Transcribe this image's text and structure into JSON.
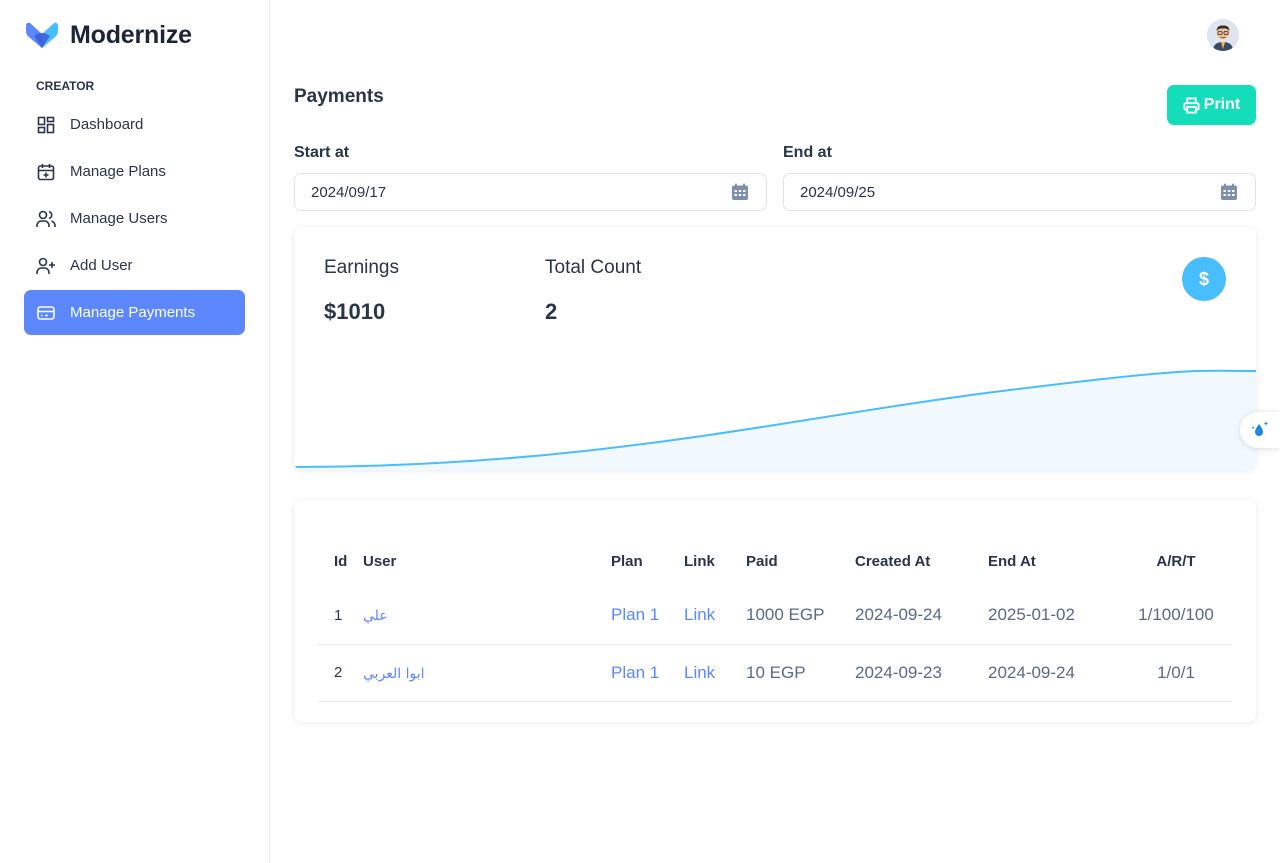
{
  "brand": {
    "name": "Modernize"
  },
  "sidebar": {
    "caption": "CREATOR",
    "items": [
      {
        "label": "Dashboard",
        "icon": "dashboard-icon"
      },
      {
        "label": "Manage Plans",
        "icon": "calendar-plus-icon"
      },
      {
        "label": "Manage Users",
        "icon": "users-icon"
      },
      {
        "label": "Add User",
        "icon": "user-plus-icon"
      },
      {
        "label": "Manage Payments",
        "icon": "credit-card-icon",
        "active": true
      }
    ]
  },
  "header": {
    "title": "Payments",
    "print_label": "Print"
  },
  "filters": {
    "start_label": "Start at",
    "start_value": "2024/09/17",
    "end_label": "End at",
    "end_value": "2024/09/25"
  },
  "stats": {
    "earnings_label": "Earnings",
    "earnings_value": "$1010",
    "count_label": "Total Count",
    "count_value": "2",
    "badge": "$"
  },
  "table": {
    "headers": [
      "Id",
      "User",
      "Plan",
      "Link",
      "Paid",
      "Created At",
      "End At",
      "A/R/T"
    ],
    "rows": [
      {
        "id": "1",
        "user": "علي",
        "plan": "Plan 1",
        "link": "Link",
        "paid": "1000 EGP",
        "created": "2024-09-24",
        "end": "2025-01-02",
        "art": "1/100/100"
      },
      {
        "id": "2",
        "user": "ابوا العربي",
        "plan": "Plan 1",
        "link": "Link",
        "paid": "10 EGP",
        "created": "2024-09-23",
        "end": "2024-09-24",
        "art": "1/0/1"
      }
    ]
  },
  "colors": {
    "primary": "#5d87ff",
    "success": "#13deb9",
    "info": "#49beff",
    "text": "#2a3547"
  }
}
